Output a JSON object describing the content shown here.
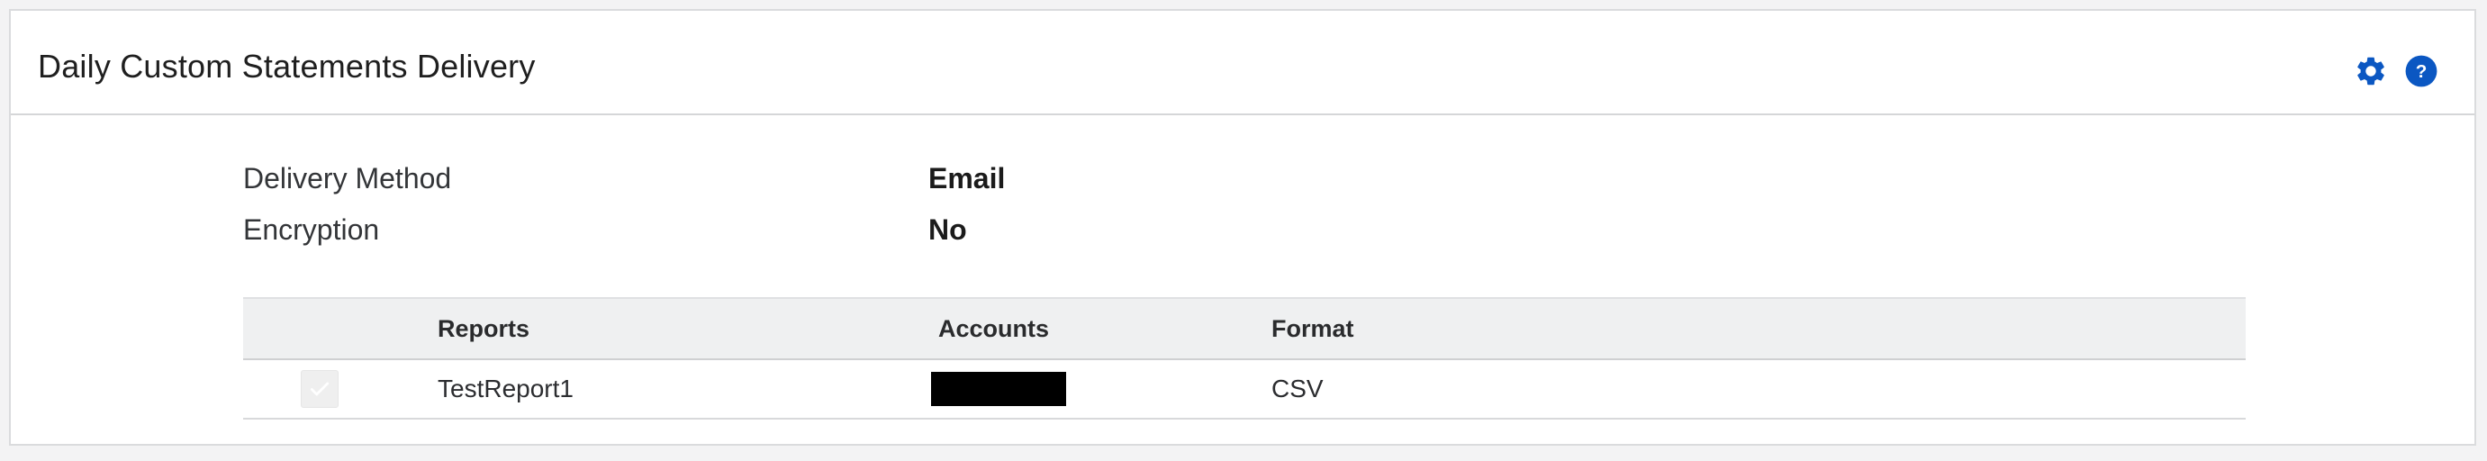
{
  "card": {
    "title": "Daily Custom Statements Delivery"
  },
  "header_icons": [
    {
      "name": "gear-icon",
      "color": "#0b57c2"
    },
    {
      "name": "help-icon",
      "color": "#0b57c2"
    }
  ],
  "settings": [
    {
      "label": "Delivery Method",
      "value": "Email"
    },
    {
      "label": "Encryption",
      "value": "No"
    }
  ],
  "table": {
    "columns": [
      "",
      "Reports",
      "Accounts",
      "Format"
    ],
    "rows": [
      {
        "checked": true,
        "report": "TestReport1",
        "accounts": "",
        "accounts_redacted": true,
        "format": "CSV"
      }
    ]
  },
  "colors": {
    "accent": "#0b57c2",
    "redaction": "#000000"
  }
}
